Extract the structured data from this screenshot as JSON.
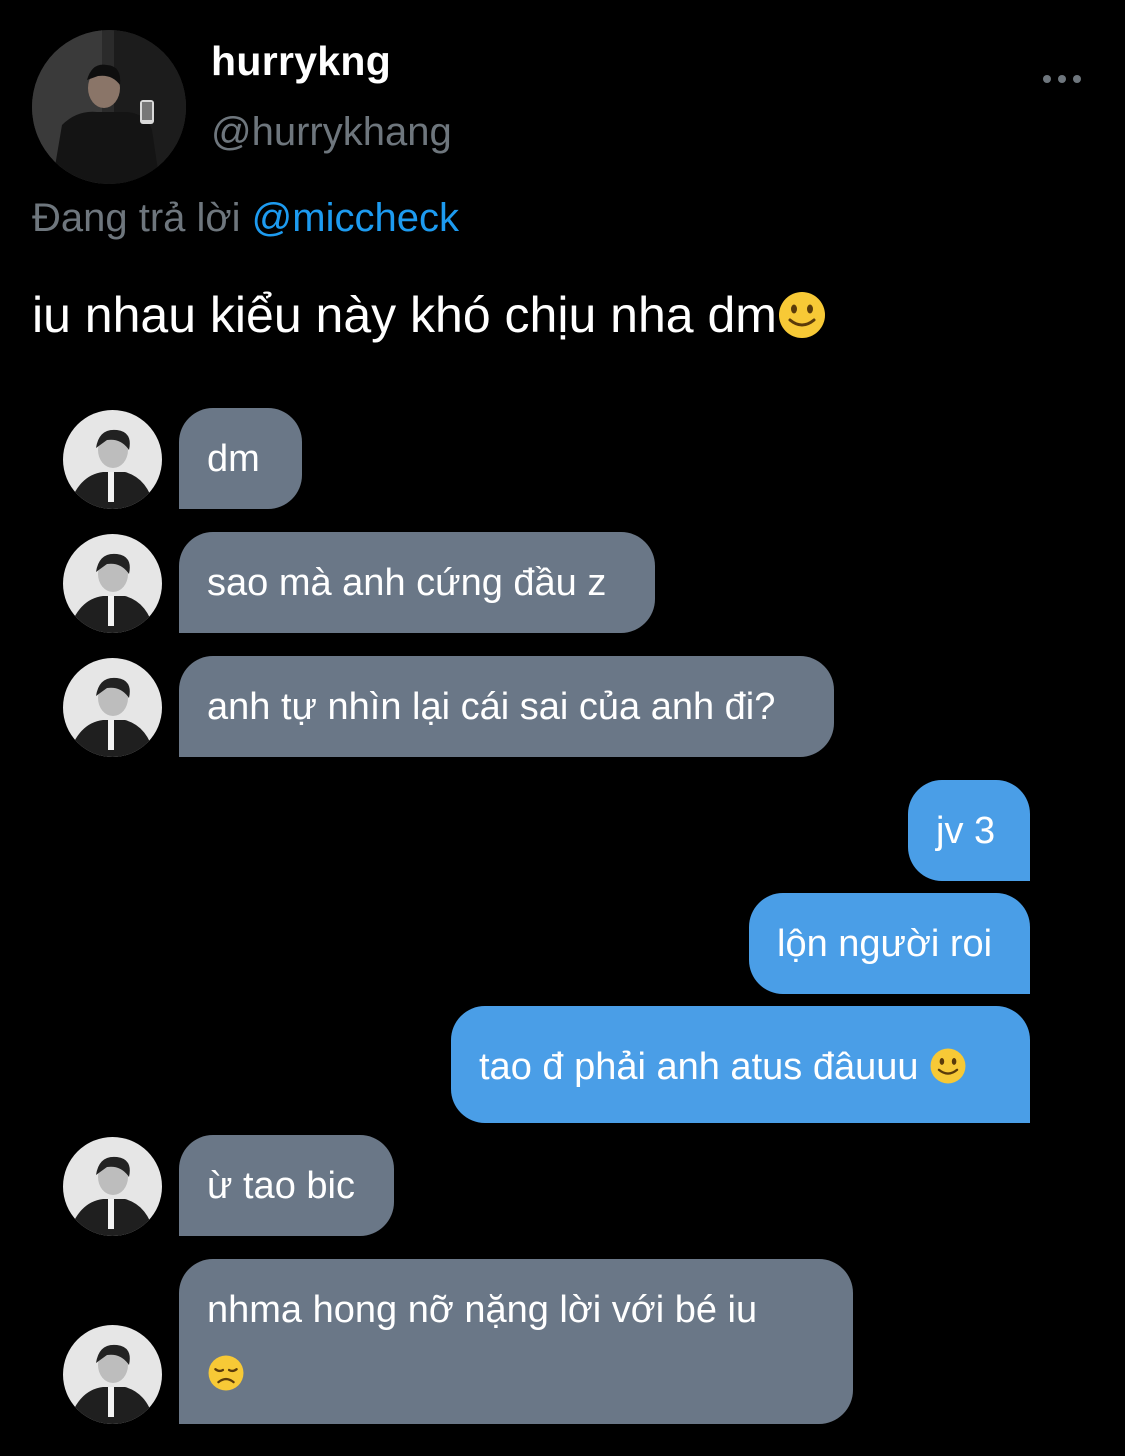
{
  "header": {
    "display_name": "hurrykng",
    "handle": "@hurrykhang",
    "more_label": "•••"
  },
  "reply": {
    "prefix": "Đang trả lời",
    "mention": "@miccheck"
  },
  "tweet": {
    "text": "iu nhau kiểu này khó chịu nha dm",
    "emoji": "slightly-smiling-face-icon"
  },
  "chat": {
    "messages": [
      {
        "side": "in",
        "text": "dm"
      },
      {
        "side": "in",
        "text": "sao mà anh cứng đầu z"
      },
      {
        "side": "in",
        "text": "anh tự nhìn lại cái sai của anh đi?"
      },
      {
        "side": "out",
        "text": "jv 3"
      },
      {
        "side": "out",
        "text": "lộn người roi"
      },
      {
        "side": "out",
        "text": "tao đ phải anh atus đâuuu",
        "emoji": "slightly-smiling-face-icon"
      },
      {
        "side": "in",
        "text": "ừ tao bic"
      },
      {
        "side": "in",
        "text": "nhma hong nỡ nặng lời với bé iu",
        "emoji": "disappointed-face-icon"
      }
    ]
  },
  "colors": {
    "background": "#000000",
    "incoming_bubble": "#6a7787",
    "outgoing_bubble": "#4a9ee7",
    "secondary_text": "#6e767d",
    "mention": "#1d9bf0"
  }
}
